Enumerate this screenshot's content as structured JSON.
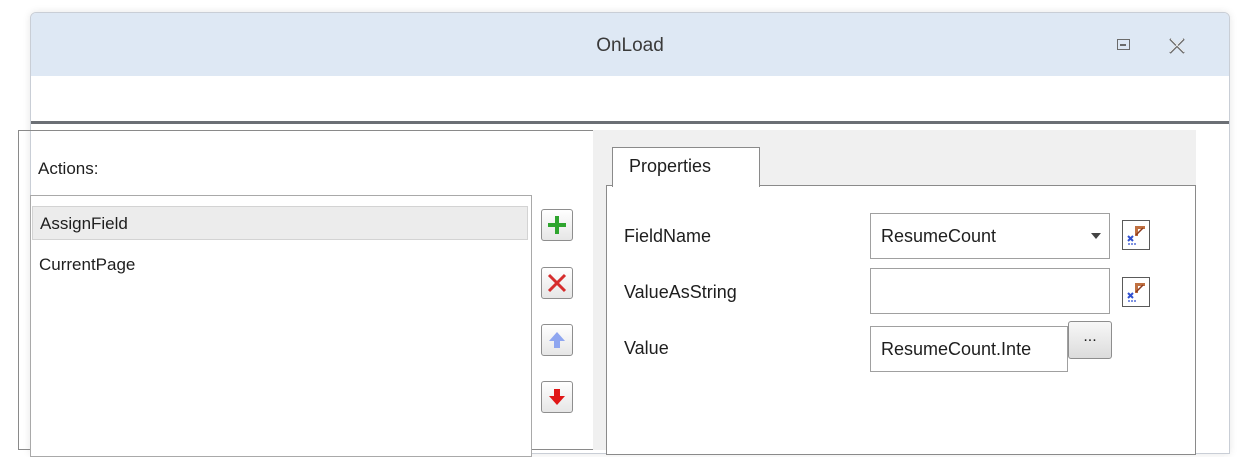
{
  "window": {
    "title": "OnLoad"
  },
  "actions": {
    "label": "Actions:",
    "items": [
      {
        "label": "AssignField",
        "selected": true
      },
      {
        "label": "CurrentPage",
        "selected": false
      }
    ],
    "buttons": {
      "add": "plus-icon",
      "delete": "x-icon",
      "move_up": "arrow-up-icon",
      "move_down": "arrow-down-icon"
    }
  },
  "properties": {
    "tab_label": "Properties",
    "rows": [
      {
        "label": "FieldName",
        "value": "ResumeCount",
        "type": "dropdown"
      },
      {
        "label": "ValueAsString",
        "value": "",
        "type": "text"
      },
      {
        "label": "Value",
        "value": "ResumeCount.Inte",
        "type": "text-with-browse"
      }
    ],
    "browse_label": "..."
  },
  "colors": {
    "titlebar": "#dee8f4",
    "add_icon": "#2fa52f",
    "delete_icon": "#d62d2d",
    "up_icon_disabled": "#8fa6f0",
    "down_icon": "#e01616"
  }
}
